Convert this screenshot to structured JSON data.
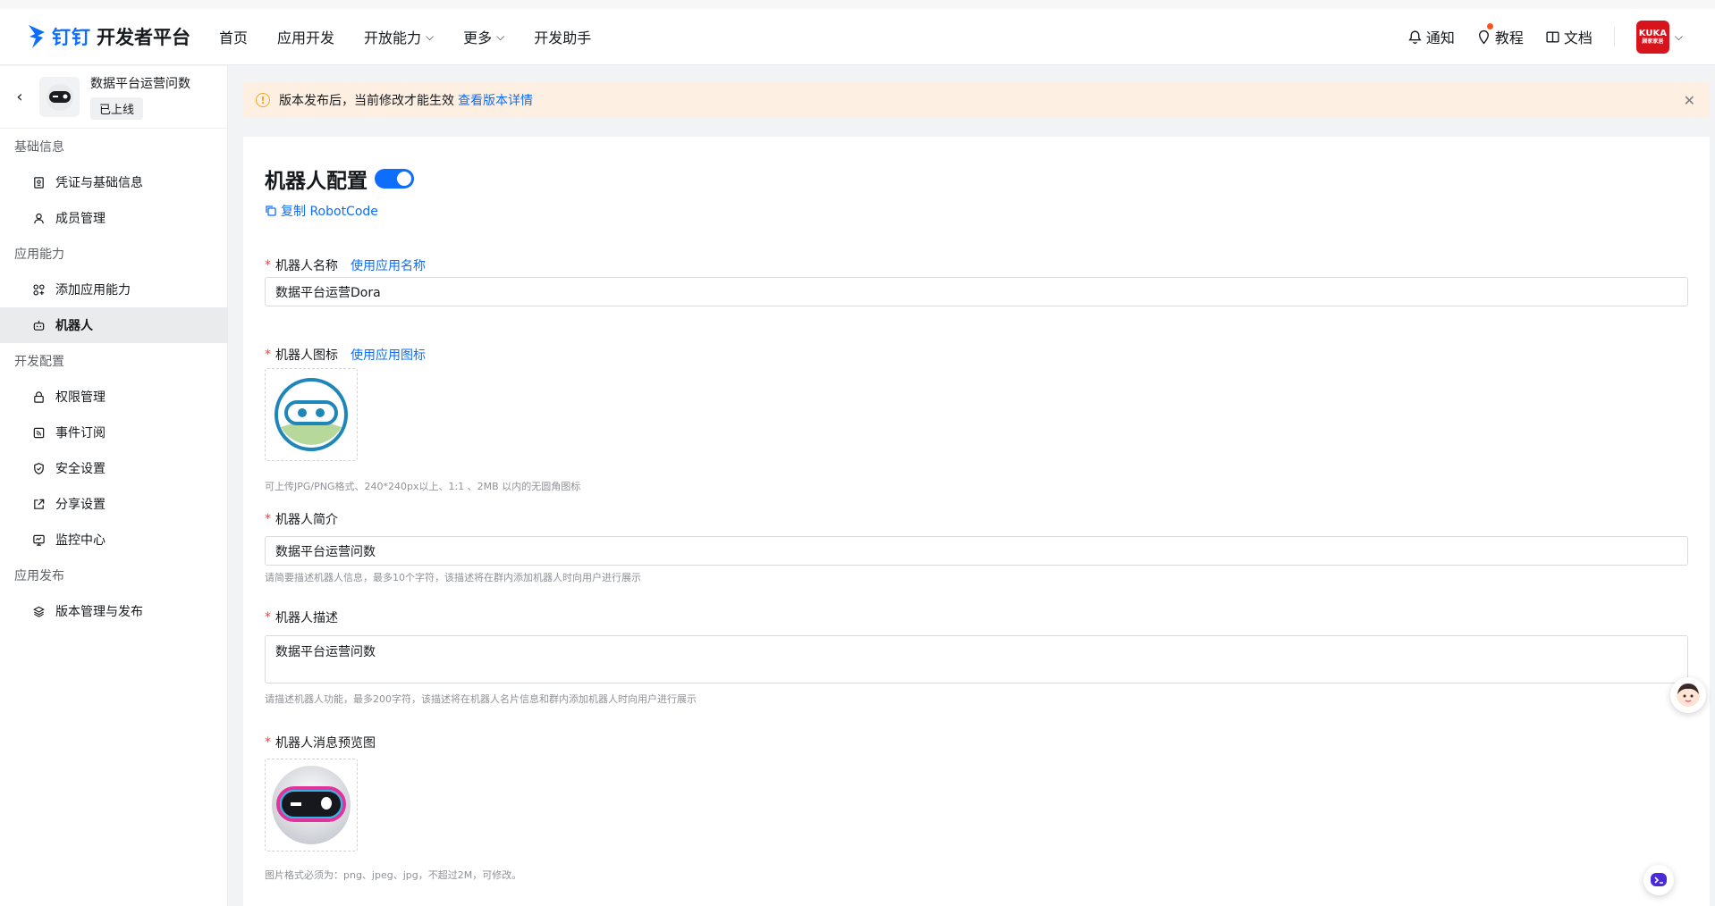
{
  "header": {
    "brand": "钉钉",
    "title": "开发者平台",
    "nav": [
      {
        "label": "首页"
      },
      {
        "label": "应用开发"
      },
      {
        "label": "开放能力"
      },
      {
        "label": "更多"
      },
      {
        "label": "开发助手"
      }
    ],
    "notify_label": "通知",
    "tutorial_label": "教程",
    "docs_label": "文档",
    "avatar_text_top": "KUKA",
    "avatar_text_bottom": "顾家家居"
  },
  "sidebar": {
    "app_name": "数据平台运营问数",
    "app_status": "已上线",
    "groups": [
      {
        "title": "基础信息",
        "items": [
          {
            "label": "凭证与基础信息",
            "icon": "credential-icon"
          },
          {
            "label": "成员管理",
            "icon": "user-icon"
          }
        ]
      },
      {
        "title": "应用能力",
        "items": [
          {
            "label": "添加应用能力",
            "icon": "apps-add-icon"
          },
          {
            "label": "机器人",
            "icon": "robot-icon"
          }
        ]
      },
      {
        "title": "开发配置",
        "items": [
          {
            "label": "权限管理",
            "icon": "lock-icon"
          },
          {
            "label": "事件订阅",
            "icon": "rss-icon"
          },
          {
            "label": "安全设置",
            "icon": "shield-icon"
          },
          {
            "label": "分享设置",
            "icon": "share-icon"
          },
          {
            "label": "监控中心",
            "icon": "monitor-icon"
          }
        ]
      },
      {
        "title": "应用发布",
        "items": [
          {
            "label": "版本管理与发布",
            "icon": "layers-icon"
          }
        ]
      }
    ],
    "active_item": "机器人"
  },
  "banner": {
    "text": "版本发布后，当前修改才能生效",
    "link": "查看版本详情"
  },
  "main": {
    "title": "机器人配置",
    "toggle_on": true,
    "copy_label": "复制 RobotCode",
    "name_label": "机器人名称",
    "name_action": "使用应用名称",
    "name_value": "数据平台运营Dora",
    "icon_label": "机器人图标",
    "icon_action": "使用应用图标",
    "icon_hint": "可上传JPG/PNG格式、240*240px以上、1:1 、2MB 以内的无圆角图标",
    "intro_label": "机器人简介",
    "intro_value": "数据平台运营问数",
    "intro_hint": "请简要描述机器人信息，最多10个字符，该描述将在群内添加机器人时向用户进行展示",
    "desc_label": "机器人描述",
    "desc_value": "数据平台运营问数",
    "desc_hint": "请描述机器人功能，最多200字符，该描述将在机器人名片信息和群内添加机器人时向用户进行展示",
    "preview_label": "机器人消息预览图",
    "preview_hint": "图片格式必须为：png、jpeg、jpg，不超过2M，可修改。"
  },
  "colors": {
    "accent": "#0d6efd",
    "banner_bg": "#fdf0e3",
    "required": "#ff3b30"
  }
}
